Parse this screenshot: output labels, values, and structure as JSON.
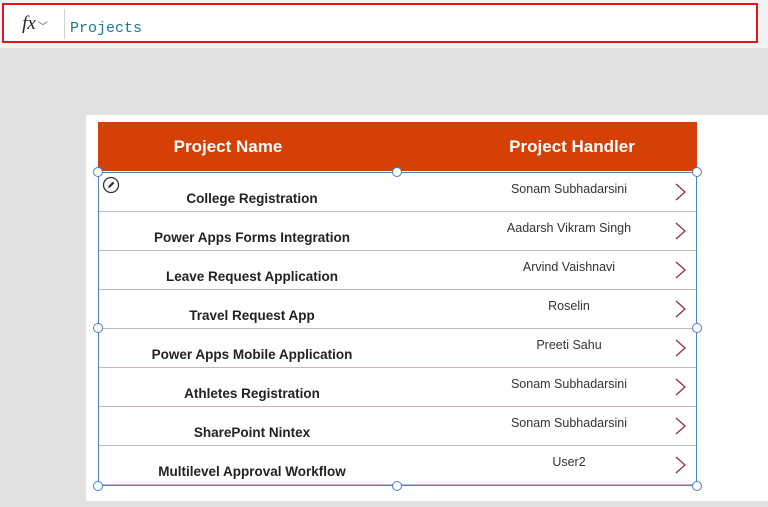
{
  "formula_bar": {
    "fx_label": "fx",
    "formula": "Projects"
  },
  "table": {
    "columns": [
      "Project Name",
      "Project Handler"
    ],
    "rows": [
      {
        "name": "College Registration",
        "handler": "Sonam Subhadarsini"
      },
      {
        "name": "Power Apps Forms Integration",
        "handler": "Aadarsh Vikram Singh"
      },
      {
        "name": "Leave Request Application",
        "handler": "Arvind Vaishnavi"
      },
      {
        "name": "Travel Request App",
        "handler": "Roselin"
      },
      {
        "name": "Power Apps Mobile Application",
        "handler": "Preeti Sahu"
      },
      {
        "name": "Athletes Registration",
        "handler": "Sonam Subhadarsini"
      },
      {
        "name": "SharePoint Nintex",
        "handler": "Sonam Subhadarsini"
      },
      {
        "name": "Multilevel Approval Workflow",
        "handler": "User2"
      }
    ]
  },
  "colors": {
    "header_bg": "#d44005",
    "highlight_border": "#e8141b",
    "selection": "#4a80c4",
    "chevron": "#9c2a4e"
  },
  "icons": {
    "edit": "pencil-circle-icon",
    "row_action": "chevron-right-icon"
  }
}
